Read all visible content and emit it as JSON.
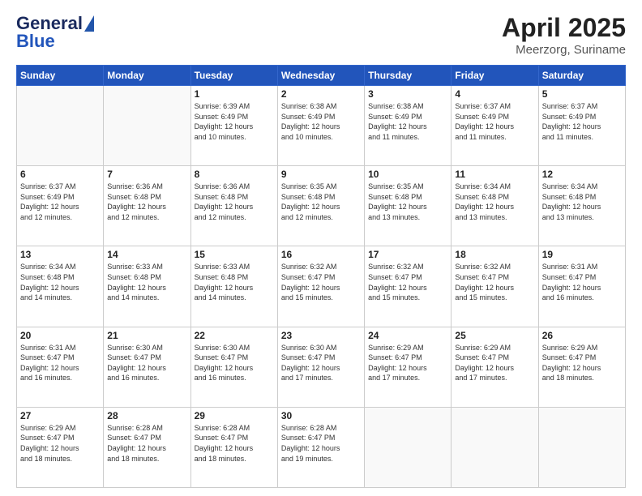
{
  "header": {
    "logo_general": "General",
    "logo_blue": "Blue",
    "month_title": "April 2025",
    "location": "Meerzorg, Suriname"
  },
  "days_of_week": [
    "Sunday",
    "Monday",
    "Tuesday",
    "Wednesday",
    "Thursday",
    "Friday",
    "Saturday"
  ],
  "weeks": [
    [
      {
        "day": "",
        "info": ""
      },
      {
        "day": "",
        "info": ""
      },
      {
        "day": "1",
        "info": "Sunrise: 6:39 AM\nSunset: 6:49 PM\nDaylight: 12 hours\nand 10 minutes."
      },
      {
        "day": "2",
        "info": "Sunrise: 6:38 AM\nSunset: 6:49 PM\nDaylight: 12 hours\nand 10 minutes."
      },
      {
        "day": "3",
        "info": "Sunrise: 6:38 AM\nSunset: 6:49 PM\nDaylight: 12 hours\nand 11 minutes."
      },
      {
        "day": "4",
        "info": "Sunrise: 6:37 AM\nSunset: 6:49 PM\nDaylight: 12 hours\nand 11 minutes."
      },
      {
        "day": "5",
        "info": "Sunrise: 6:37 AM\nSunset: 6:49 PM\nDaylight: 12 hours\nand 11 minutes."
      }
    ],
    [
      {
        "day": "6",
        "info": "Sunrise: 6:37 AM\nSunset: 6:49 PM\nDaylight: 12 hours\nand 12 minutes."
      },
      {
        "day": "7",
        "info": "Sunrise: 6:36 AM\nSunset: 6:48 PM\nDaylight: 12 hours\nand 12 minutes."
      },
      {
        "day": "8",
        "info": "Sunrise: 6:36 AM\nSunset: 6:48 PM\nDaylight: 12 hours\nand 12 minutes."
      },
      {
        "day": "9",
        "info": "Sunrise: 6:35 AM\nSunset: 6:48 PM\nDaylight: 12 hours\nand 12 minutes."
      },
      {
        "day": "10",
        "info": "Sunrise: 6:35 AM\nSunset: 6:48 PM\nDaylight: 12 hours\nand 13 minutes."
      },
      {
        "day": "11",
        "info": "Sunrise: 6:34 AM\nSunset: 6:48 PM\nDaylight: 12 hours\nand 13 minutes."
      },
      {
        "day": "12",
        "info": "Sunrise: 6:34 AM\nSunset: 6:48 PM\nDaylight: 12 hours\nand 13 minutes."
      }
    ],
    [
      {
        "day": "13",
        "info": "Sunrise: 6:34 AM\nSunset: 6:48 PM\nDaylight: 12 hours\nand 14 minutes."
      },
      {
        "day": "14",
        "info": "Sunrise: 6:33 AM\nSunset: 6:48 PM\nDaylight: 12 hours\nand 14 minutes."
      },
      {
        "day": "15",
        "info": "Sunrise: 6:33 AM\nSunset: 6:48 PM\nDaylight: 12 hours\nand 14 minutes."
      },
      {
        "day": "16",
        "info": "Sunrise: 6:32 AM\nSunset: 6:47 PM\nDaylight: 12 hours\nand 15 minutes."
      },
      {
        "day": "17",
        "info": "Sunrise: 6:32 AM\nSunset: 6:47 PM\nDaylight: 12 hours\nand 15 minutes."
      },
      {
        "day": "18",
        "info": "Sunrise: 6:32 AM\nSunset: 6:47 PM\nDaylight: 12 hours\nand 15 minutes."
      },
      {
        "day": "19",
        "info": "Sunrise: 6:31 AM\nSunset: 6:47 PM\nDaylight: 12 hours\nand 16 minutes."
      }
    ],
    [
      {
        "day": "20",
        "info": "Sunrise: 6:31 AM\nSunset: 6:47 PM\nDaylight: 12 hours\nand 16 minutes."
      },
      {
        "day": "21",
        "info": "Sunrise: 6:30 AM\nSunset: 6:47 PM\nDaylight: 12 hours\nand 16 minutes."
      },
      {
        "day": "22",
        "info": "Sunrise: 6:30 AM\nSunset: 6:47 PM\nDaylight: 12 hours\nand 16 minutes."
      },
      {
        "day": "23",
        "info": "Sunrise: 6:30 AM\nSunset: 6:47 PM\nDaylight: 12 hours\nand 17 minutes."
      },
      {
        "day": "24",
        "info": "Sunrise: 6:29 AM\nSunset: 6:47 PM\nDaylight: 12 hours\nand 17 minutes."
      },
      {
        "day": "25",
        "info": "Sunrise: 6:29 AM\nSunset: 6:47 PM\nDaylight: 12 hours\nand 17 minutes."
      },
      {
        "day": "26",
        "info": "Sunrise: 6:29 AM\nSunset: 6:47 PM\nDaylight: 12 hours\nand 18 minutes."
      }
    ],
    [
      {
        "day": "27",
        "info": "Sunrise: 6:29 AM\nSunset: 6:47 PM\nDaylight: 12 hours\nand 18 minutes."
      },
      {
        "day": "28",
        "info": "Sunrise: 6:28 AM\nSunset: 6:47 PM\nDaylight: 12 hours\nand 18 minutes."
      },
      {
        "day": "29",
        "info": "Sunrise: 6:28 AM\nSunset: 6:47 PM\nDaylight: 12 hours\nand 18 minutes."
      },
      {
        "day": "30",
        "info": "Sunrise: 6:28 AM\nSunset: 6:47 PM\nDaylight: 12 hours\nand 19 minutes."
      },
      {
        "day": "",
        "info": ""
      },
      {
        "day": "",
        "info": ""
      },
      {
        "day": "",
        "info": ""
      }
    ]
  ]
}
